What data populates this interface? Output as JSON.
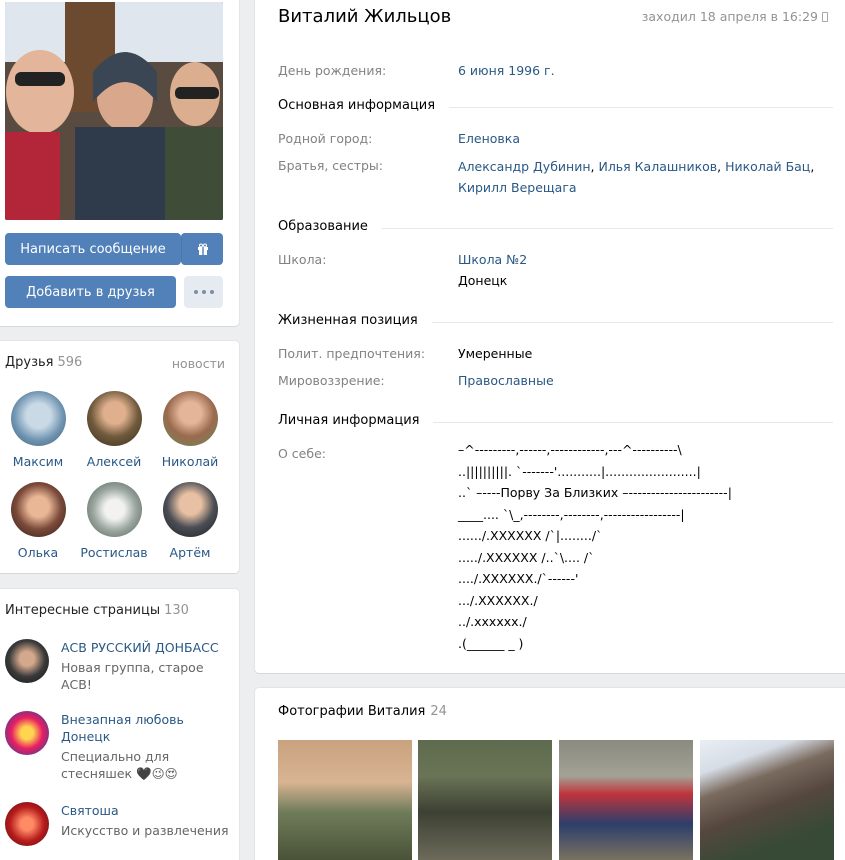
{
  "profile": {
    "message_button": "Написать сообщение",
    "add_friend_button": "Добавить в друзья"
  },
  "friends": {
    "title": "Друзья",
    "count": "596",
    "updates_link": "новости",
    "list": [
      {
        "name": "Максим",
        "color": "#8fb0c8"
      },
      {
        "name": "Алексей",
        "color": "#6f5a3c"
      },
      {
        "name": "Николай",
        "color": "#9a6a4f"
      },
      {
        "name": "Олька",
        "color": "#7b4a3a"
      },
      {
        "name": "Ростислав",
        "color": "#7d8a80"
      },
      {
        "name": "Артём",
        "color": "#4b4e55"
      }
    ]
  },
  "interests": {
    "title": "Интересные страницы",
    "count": "130",
    "pages": [
      {
        "title": "АСВ РУССКИЙ ДОНБАСС",
        "subtitle": "Новая группа, старое АСВ!",
        "color": "#3a3a3a"
      },
      {
        "title": "Внезапная любовь Донецк",
        "subtitle": "Специально для стесняшек 🖤😉😍",
        "color": "#c2185b"
      },
      {
        "title": "Святоша",
        "subtitle": "Искусство и развлечения",
        "color": "#b71c1c"
      }
    ]
  },
  "info": {
    "name": "Виталий Жильцов",
    "last_seen": "заходил 18 апреля в 16:29",
    "birthday_label": "День рождения:",
    "birthday_value": "6 июня 1996 г.",
    "section_main": "Основная информация",
    "hometown_label": "Родной город:",
    "hometown_value": "Еленовка",
    "siblings_label": "Братья, сестры:",
    "siblings": [
      "Александр Дубинин",
      "Илья Калашников",
      "Николай Бац",
      "Кирилл Верещага"
    ],
    "section_education": "Образование",
    "school_label": "Школа:",
    "school_value": "Школа №2",
    "school_city": "Донецк",
    "section_position": "Жизненная позиция",
    "politics_label": "Полит. предпочтения:",
    "politics_value": "Умеренные",
    "worldview_label": "Мировоззрение:",
    "worldview_value": "Православные",
    "section_personal": "Личная информация",
    "about_label": "О себе:",
    "about_text": [
      "–^---------,------,------------,---^----------\\",
      "..||||||||||. `-------'...........|.......................|",
      "..` –----Порву За Близких –----------------------|",
      "____.... `\\_,--------,--------,-----------------|",
      "....../.XXXXXX /`|......../`",
      "...../.XXXXXX /..`\\.... /`",
      "..../.XXXXXX./`------'",
      ".../.XXXXXX./",
      "../.xxxxxx./",
      ".(______ _ )"
    ]
  },
  "photos": {
    "title": "Фотографии Виталия",
    "count": "24"
  }
}
